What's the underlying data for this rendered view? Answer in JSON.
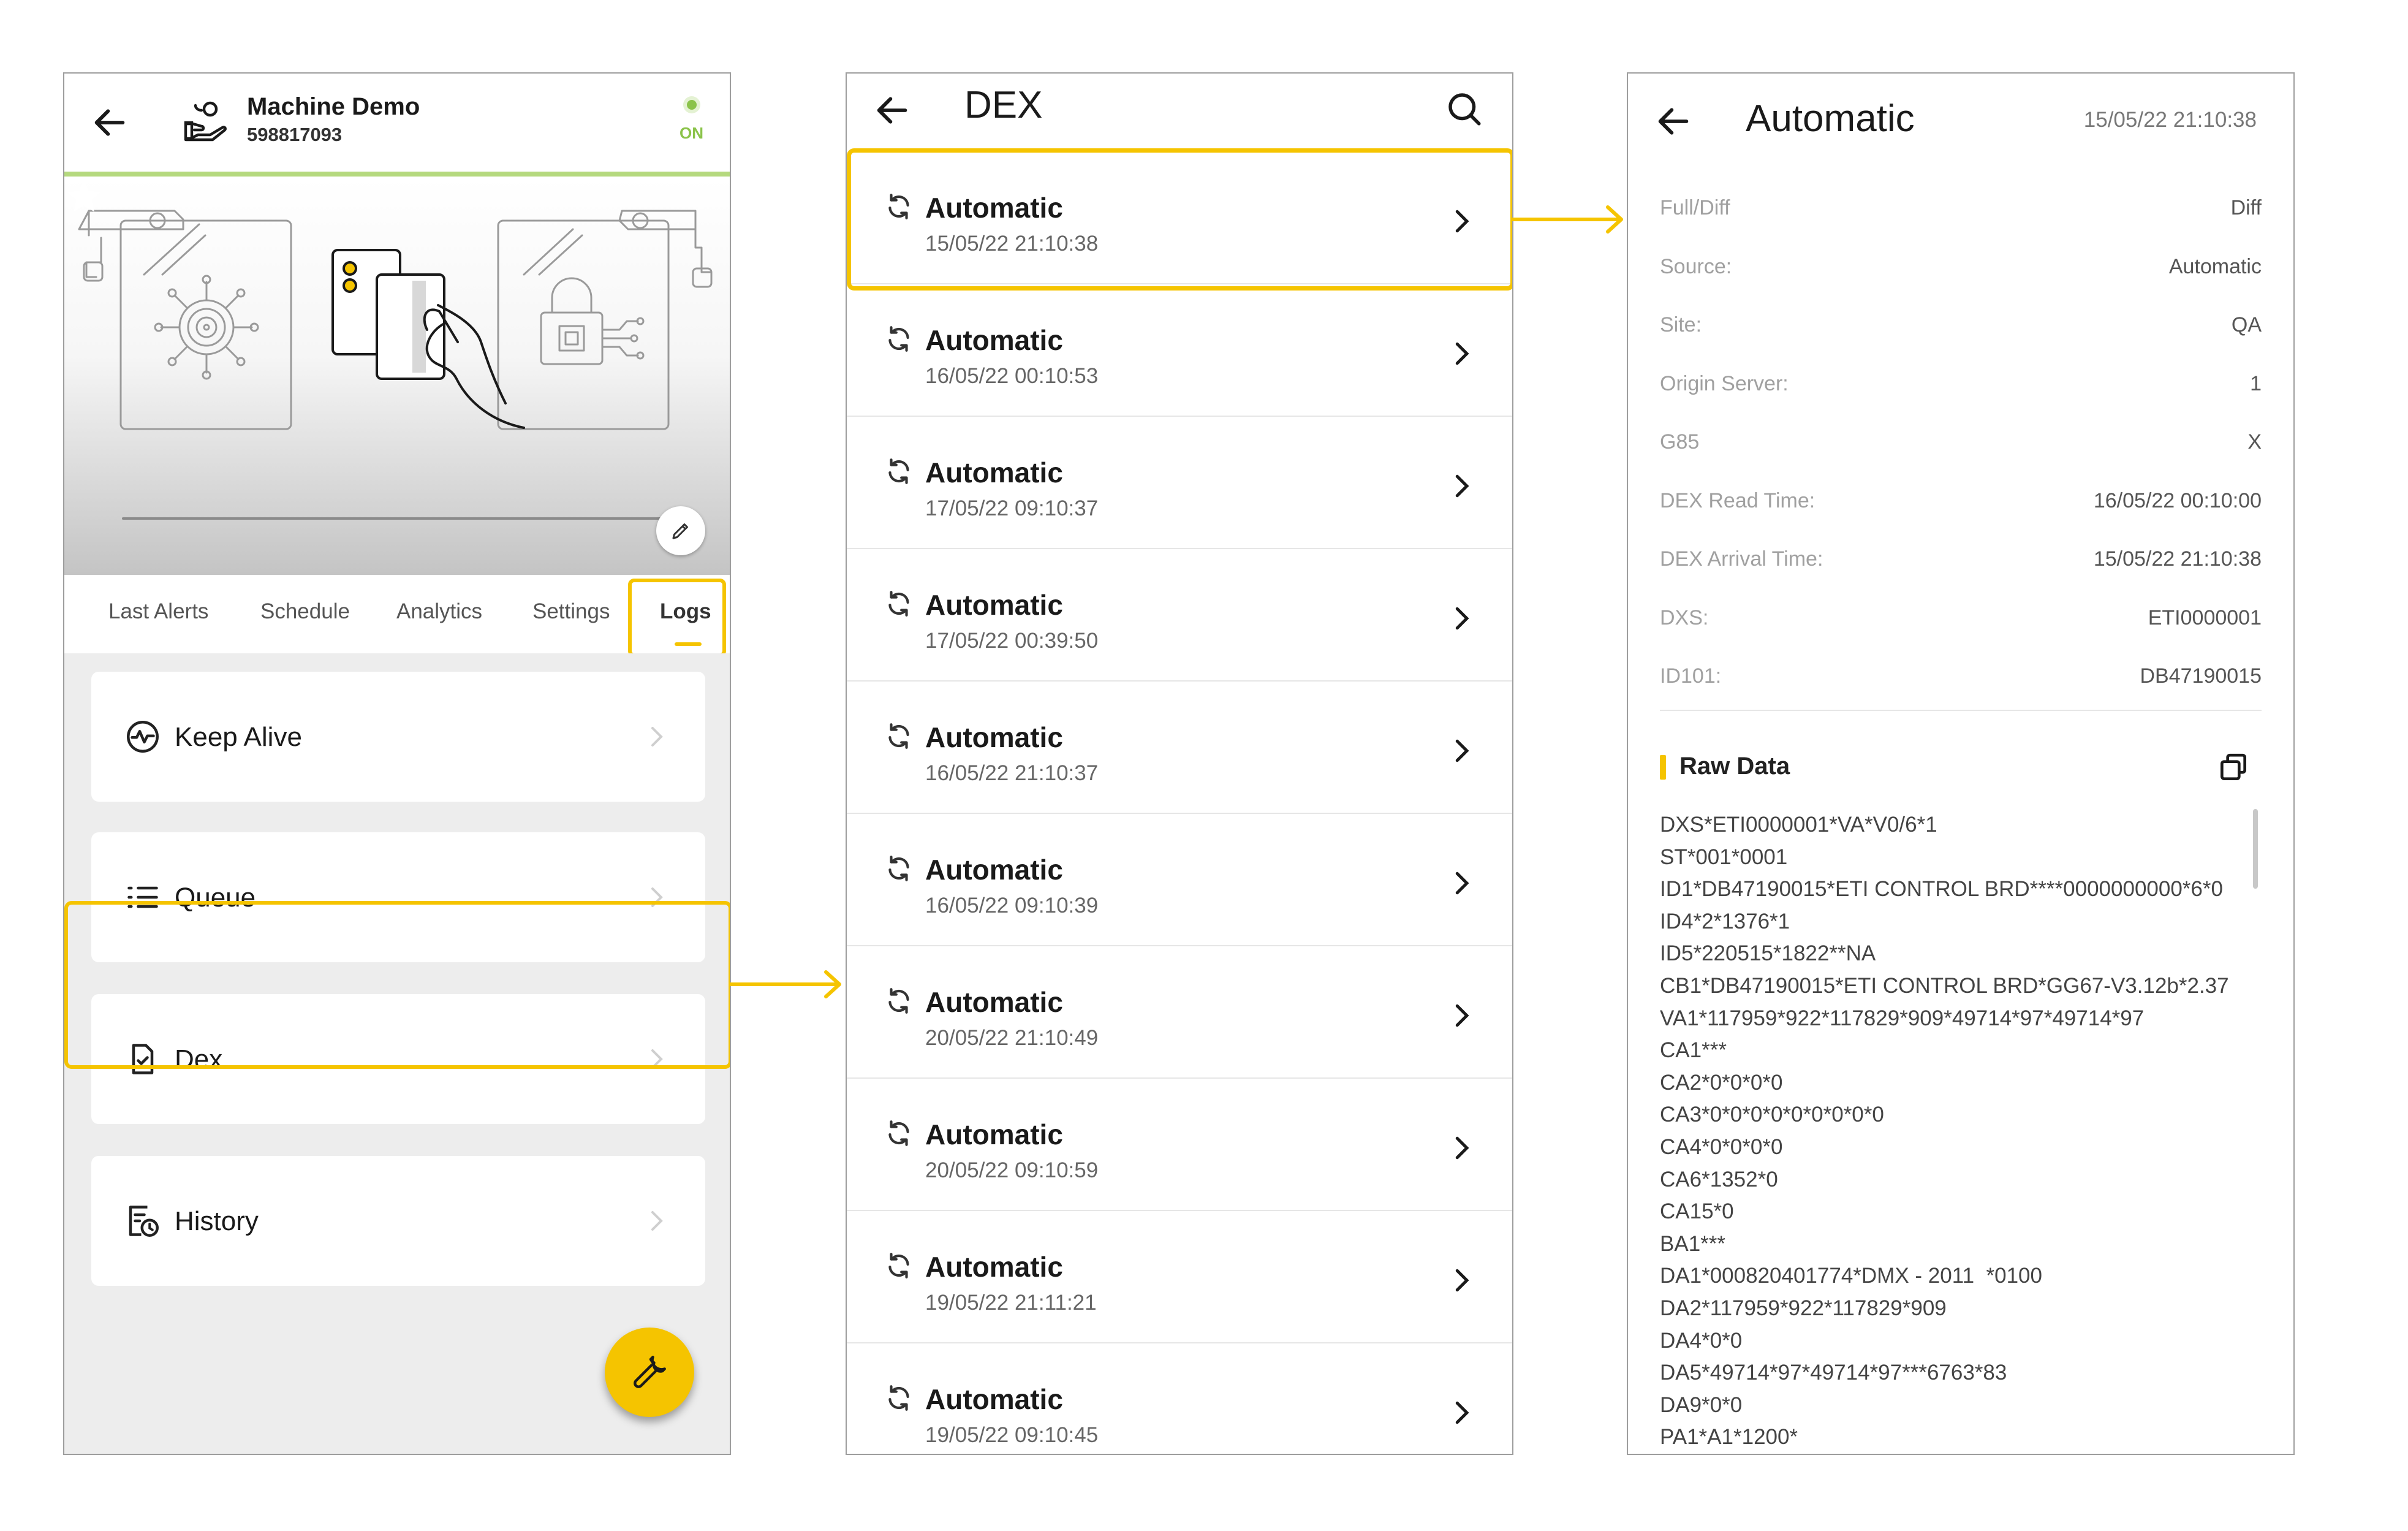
{
  "colors": {
    "accent": "#f5c400",
    "status_on": "#8bc34a",
    "background": "#ededed"
  },
  "screen1": {
    "machine_name": "Machine Demo",
    "serial": "598817093",
    "status": "ON",
    "tabs": [
      {
        "label": "Last Alerts"
      },
      {
        "label": "Schedule"
      },
      {
        "label": "Analytics"
      },
      {
        "label": "Settings"
      },
      {
        "label": "Logs"
      }
    ],
    "menu": [
      {
        "label": "Keep Alive",
        "icon": "pulse-icon"
      },
      {
        "label": "Queue",
        "icon": "list-icon"
      },
      {
        "label": "Dex",
        "icon": "file-check-icon"
      },
      {
        "label": "History",
        "icon": "history-icon"
      }
    ],
    "fab_icon": "wrench-icon"
  },
  "screen2": {
    "title": "DEX",
    "items": [
      {
        "name": "Automatic",
        "time": "15/05/22 21:10:38"
      },
      {
        "name": "Automatic",
        "time": "16/05/22 00:10:53"
      },
      {
        "name": "Automatic",
        "time": "17/05/22 09:10:37"
      },
      {
        "name": "Automatic",
        "time": "17/05/22 00:39:50"
      },
      {
        "name": "Automatic",
        "time": "16/05/22 21:10:37"
      },
      {
        "name": "Automatic",
        "time": "16/05/22 09:10:39"
      },
      {
        "name": "Automatic",
        "time": "20/05/22 21:10:49"
      },
      {
        "name": "Automatic",
        "time": "20/05/22 09:10:59"
      },
      {
        "name": "Automatic",
        "time": "19/05/22 21:11:21"
      },
      {
        "name": "Automatic",
        "time": "19/05/22 09:10:45"
      }
    ]
  },
  "screen3": {
    "title": "Automatic",
    "date": "15/05/22 21:10:38",
    "fields": [
      {
        "label": "Full/Diff",
        "value": "Diff"
      },
      {
        "label": "Source:",
        "value": "Automatic"
      },
      {
        "label": "Site:",
        "value": "QA"
      },
      {
        "label": "Origin Server:",
        "value": "1"
      },
      {
        "label": "G85",
        "value": "X"
      },
      {
        "label": "DEX Read Time:",
        "value": "16/05/22 00:10:00"
      },
      {
        "label": "DEX Arrival Time:",
        "value": "15/05/22 21:10:38"
      },
      {
        "label": "DXS:",
        "value": "ETI0000001"
      },
      {
        "label": "ID101:",
        "value": "DB47190015"
      }
    ],
    "raw_title": "Raw Data",
    "raw_lines": [
      "DXS*ETI0000001*VA*V0/6*1",
      "ST*001*0001",
      "ID1*DB47190015*ETI CONTROL BRD****0000000000*6*0",
      "ID4*2*1376*1",
      "ID5*220515*1822**NA",
      "CB1*DB47190015*ETI CONTROL BRD*GG67-V3.12b*2.37",
      "VA1*117959*922*117829*909*49714*97*49714*97",
      "CA1***",
      "CA2*0*0*0*0",
      "CA3*0*0*0*0*0*0*0*0*0",
      "CA4*0*0*0*0",
      "CA6*1352*0",
      "CA15*0",
      "BA1***",
      "DA1*000820401774*DMX - 2011  *0100",
      "DA2*117959*922*117829*909",
      "DA4*0*0",
      "DA5*49714*97*49714*97***6763*83",
      "DA9*0*0",
      "PA1*A1*1200*"
    ]
  }
}
